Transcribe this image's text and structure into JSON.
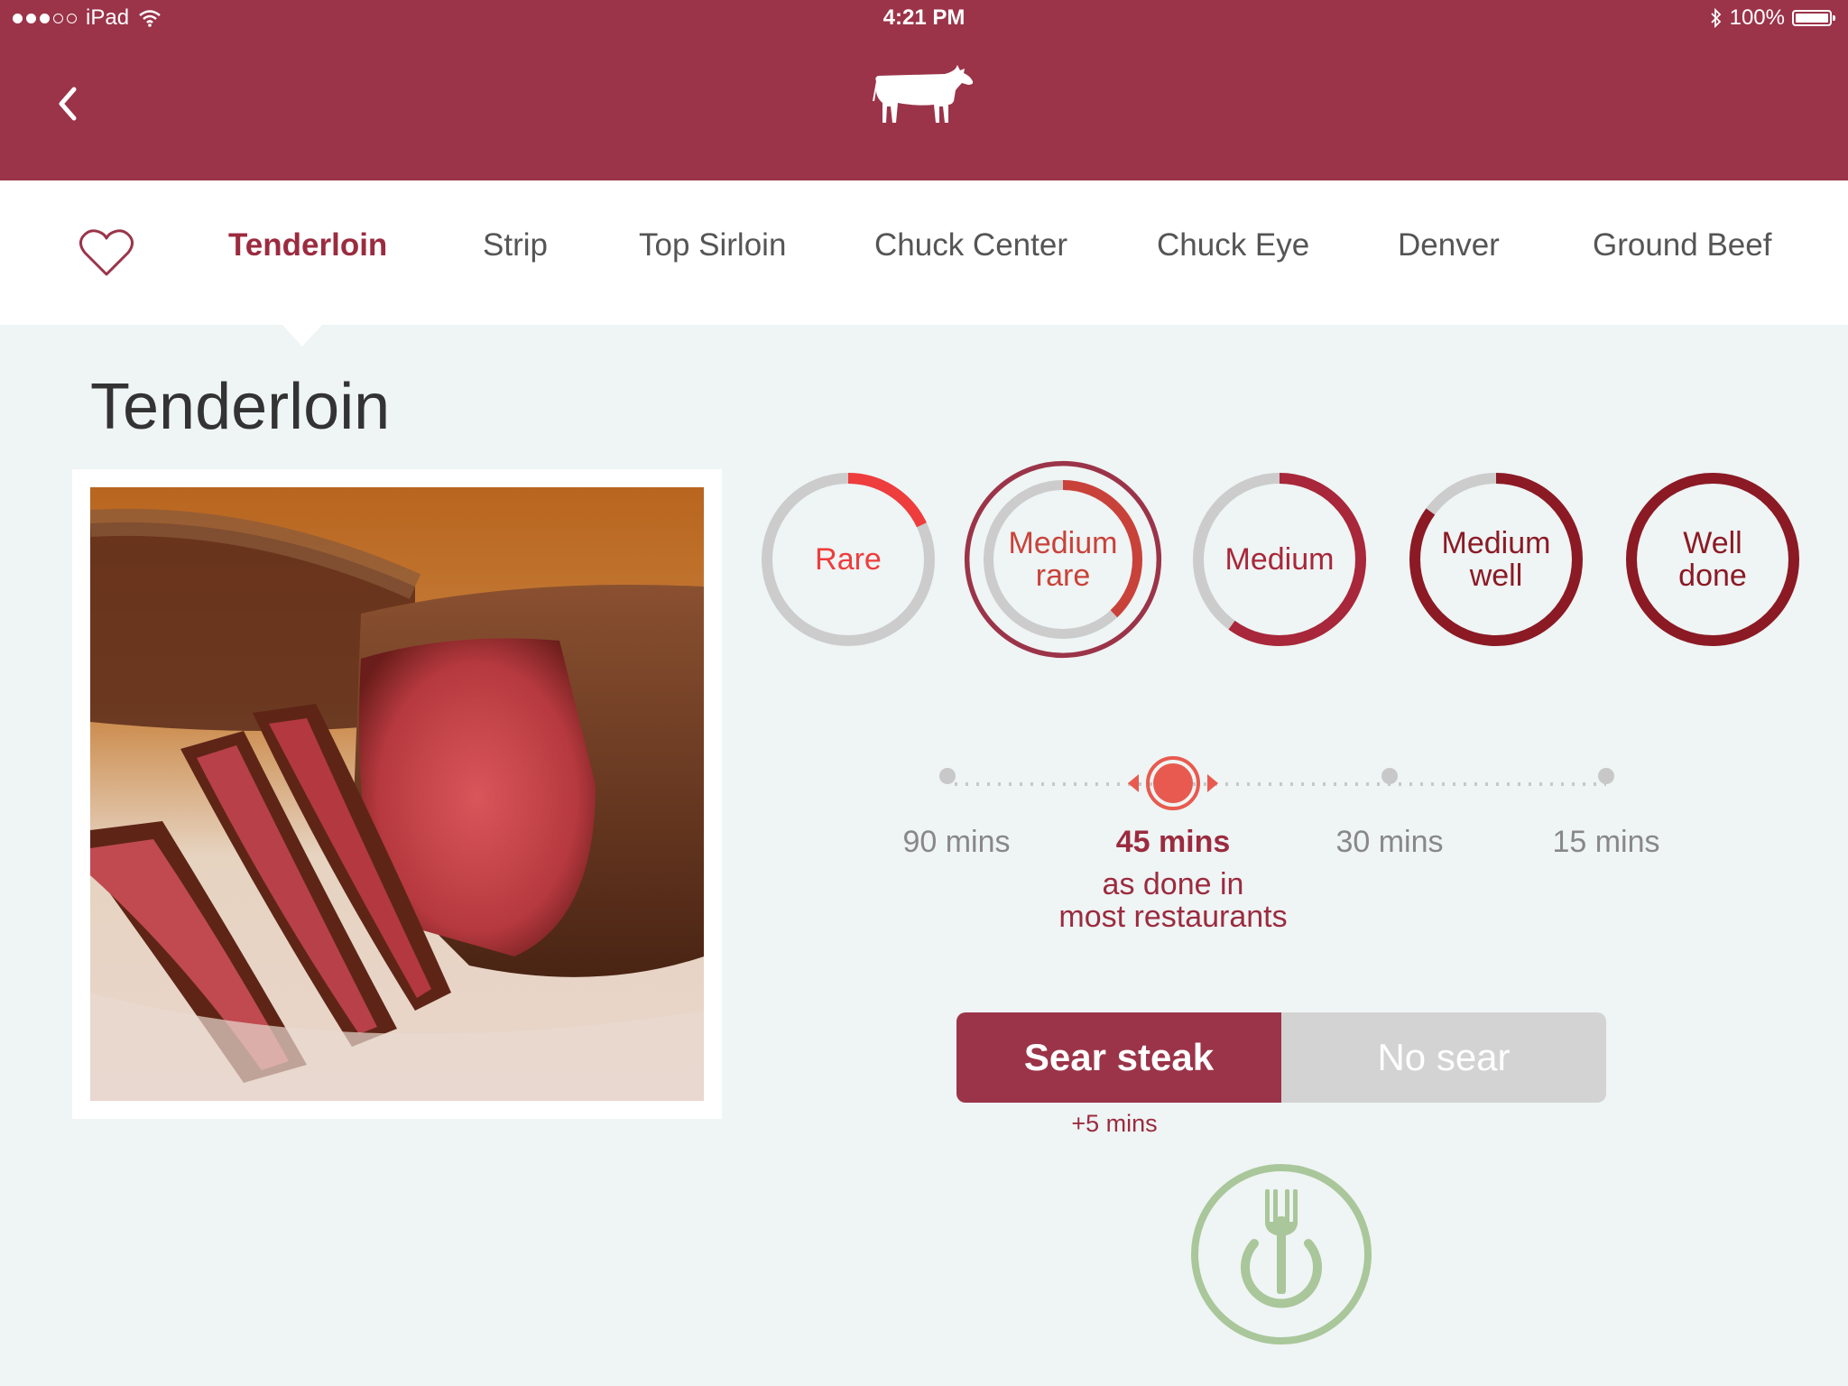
{
  "status_bar": {
    "carrier": "iPad",
    "time": "4:21 PM",
    "battery": "100%",
    "signal_icons": [
      "signal-dots-icon",
      "wifi-icon",
      "bluetooth-icon",
      "battery-icon"
    ]
  },
  "header": {
    "back_icon": "chevron-left-icon",
    "logo_icon": "cow-icon"
  },
  "tabs": {
    "favorite_icon": "heart-icon",
    "items": [
      {
        "label": "Tenderloin",
        "active": true
      },
      {
        "label": "Strip",
        "active": false
      },
      {
        "label": "Top Sirloin",
        "active": false
      },
      {
        "label": "Chuck Center",
        "active": false
      },
      {
        "label": "Chuck Eye",
        "active": false
      },
      {
        "label": "Denver",
        "active": false
      },
      {
        "label": "Ground Beef",
        "active": false
      }
    ]
  },
  "main": {
    "title": "Tenderloin",
    "photo": "sliced-steak-image"
  },
  "doneness": {
    "selected": "Medium rare",
    "options": [
      {
        "label": "Rare",
        "fill": 0.18,
        "color": "#ee3d3d"
      },
      {
        "label": "Medium\nrare",
        "fill": 0.38,
        "color": "#c9423a"
      },
      {
        "label": "Medium",
        "fill": 0.6,
        "color": "#a8273a"
      },
      {
        "label": "Medium\nwell",
        "fill": 0.85,
        "color": "#8b1a25"
      },
      {
        "label": "Well\ndone",
        "fill": 1.0,
        "color": "#8b1a25"
      }
    ],
    "track_color": "#cccccc",
    "selected_ring_color": "#9b3449"
  },
  "timer": {
    "options": [
      "90 mins",
      "45 mins",
      "30 mins",
      "15 mins"
    ],
    "selected_index": 1,
    "selected_note": "as done in\nmost restaurants"
  },
  "sear": {
    "on_label": "Sear steak",
    "off_label": "No sear",
    "extra_time": "+5 mins",
    "selected": "Sear steak"
  },
  "start_button": {
    "icon": "fork-power-icon",
    "color": "#a9c79a"
  },
  "colors": {
    "brand": "#9b3449",
    "accent": "#e85a4f",
    "background": "#eff4f4"
  }
}
